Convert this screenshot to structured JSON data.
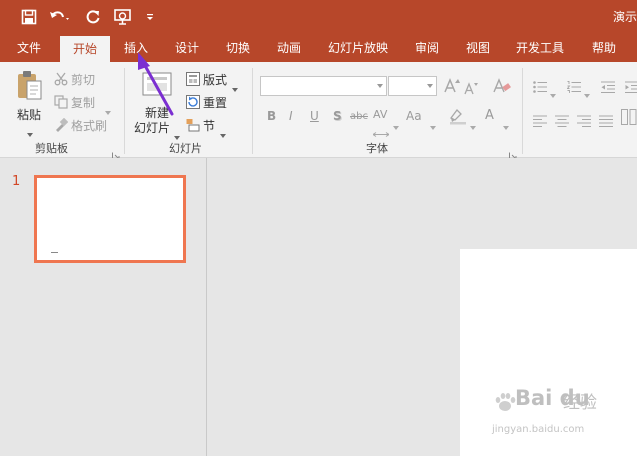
{
  "window": {
    "doc_title": "演示"
  },
  "qat": {
    "save_icon": "save-icon",
    "undo_icon": "undo-icon",
    "redo_icon": "repeat-icon",
    "present_icon": "start-from-beginning-icon",
    "customize_icon": "customize-qat-icon"
  },
  "tabs": [
    {
      "label": "文件"
    },
    {
      "label": "开始"
    },
    {
      "label": "插入"
    },
    {
      "label": "设计"
    },
    {
      "label": "切换"
    },
    {
      "label": "动画"
    },
    {
      "label": "幻灯片放映"
    },
    {
      "label": "审阅"
    },
    {
      "label": "视图"
    },
    {
      "label": "开发工具"
    },
    {
      "label": "帮助"
    }
  ],
  "ribbon": {
    "clipboard": {
      "label": "剪贴板",
      "paste": "粘贴",
      "cut": "剪切",
      "copy": "复制",
      "format_painter": "格式刷"
    },
    "slides": {
      "label": "幻灯片",
      "new_slide_line1": "新建",
      "new_slide_line2": "幻灯片",
      "layout": "版式",
      "reset": "重置",
      "section": "节"
    },
    "font": {
      "label": "字体",
      "font_name_value": "",
      "font_size_value": "",
      "bold": "B",
      "italic": "I",
      "underline": "U",
      "shadow": "S",
      "strikethrough": "abc",
      "spacing": "AV",
      "change_case": "Aa",
      "font_color": "A"
    }
  },
  "slides_panel": {
    "slide_number": "1"
  },
  "watermark": {
    "brand": "Bai du",
    "cn": "经验",
    "url": "jingyan.baidu.com"
  },
  "colors": {
    "accent": "#b7472a",
    "thumb_border": "#ef7650",
    "annotation_arrow": "#7b2fd1"
  }
}
